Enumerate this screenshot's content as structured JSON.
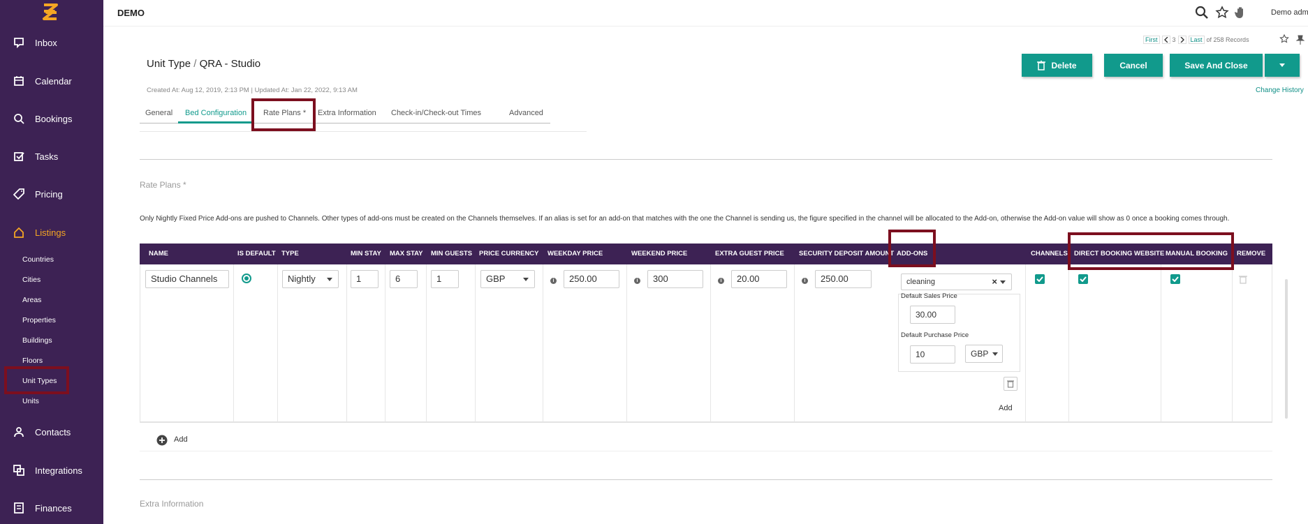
{
  "sidebar": {
    "items": [
      {
        "label": "Inbox",
        "icon": "inbox-icon"
      },
      {
        "label": "Calendar",
        "icon": "calendar-icon"
      },
      {
        "label": "Bookings",
        "icon": "bookings-icon"
      },
      {
        "label": "Tasks",
        "icon": "tasks-icon"
      },
      {
        "label": "Pricing",
        "icon": "tag-icon"
      },
      {
        "label": "Listings",
        "icon": "home-icon"
      },
      {
        "label": "Contacts",
        "icon": "contacts-icon"
      },
      {
        "label": "Integrations",
        "icon": "integrations-icon"
      },
      {
        "label": "Finances",
        "icon": "finances-icon"
      }
    ],
    "sub_items": [
      "Countries",
      "Cities",
      "Areas",
      "Properties",
      "Buildings",
      "Floors",
      "Unit Types",
      "Units"
    ]
  },
  "topbar": {
    "org_name": "DEMO",
    "user_name": "Demo adm",
    "icons": [
      "search-icon",
      "star-icon",
      "hand-icon"
    ]
  },
  "record_nav": {
    "first": "First",
    "page": "3",
    "last": "Last",
    "count_text": "of 258 Records"
  },
  "header": {
    "breadcrumb": "Unit Type",
    "separator": "/",
    "title": "QRA - Studio",
    "meta": "Created At: Aug 12, 2019, 2:13 PM  |  Updated At: Jan 22, 2022, 9:13 AM",
    "delete_label": "Delete",
    "cancel_label": "Cancel",
    "save_close_label": "Save And Close",
    "change_history": "Change History"
  },
  "tabs": [
    "General",
    "Bed Configuration",
    "Rate Plans *",
    "Extra Information",
    "Check-in/Check-out Times",
    "Advanced"
  ],
  "rate_plans": {
    "section_title": "Rate Plans *",
    "note": "Only Nightly Fixed Price Add-ons are pushed to Channels. Other types of add-ons must be created on the Channels themselves. If an alias is set for an add-on that matches with the one the Channel is sending us, the figure specified in the channel will be allocated to the Add-on, otherwise the Add-on value will show as 0 once a booking comes through.",
    "columns": [
      "NAME",
      "IS DEFAULT",
      "TYPE",
      "MIN STAY",
      "MAX STAY",
      "MIN GUESTS",
      "PRICE CURRENCY",
      "WEEKDAY PRICE",
      "WEEKEND PRICE",
      "EXTRA GUEST PRICE",
      "SECURITY DEPOSIT AMOUNT",
      "ADD-ONS",
      "CHANNELS",
      "DIRECT BOOKING WEBSITE",
      "MANUAL BOOKING",
      "REMOVE"
    ],
    "row": {
      "name": "Studio Channels",
      "is_default": true,
      "type": "Nightly",
      "min_stay": "1",
      "max_stay": "6",
      "min_guests": "1",
      "currency": "GBP",
      "weekday_price": "250.00",
      "weekend_price": "300",
      "extra_guest_price": "20.00",
      "security_deposit": "250.00",
      "addon": {
        "name": "cleaning",
        "default_sales_label": "Default Sales Price",
        "default_sales_value": "30.00",
        "default_purchase_label": "Default Purchase Price",
        "default_purchase_value": "10",
        "purchase_currency": "GBP",
        "add_label": "Add"
      },
      "channels": true,
      "direct_booking": true,
      "manual_booking": true
    },
    "add_label": "Add"
  },
  "extra_info": {
    "section_title": "Extra Information"
  },
  "colors": {
    "sidebar": "#3d2254",
    "accent": "#119a8c",
    "highlight": "#7c0f1f",
    "active_nav": "#f5a623"
  }
}
